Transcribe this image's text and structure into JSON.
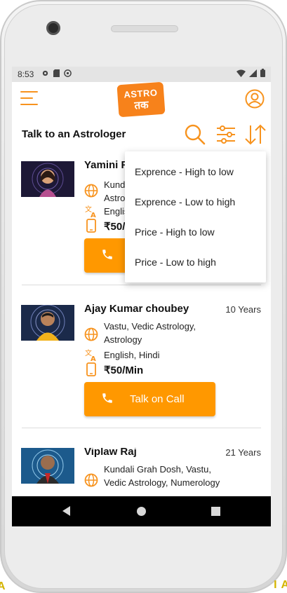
{
  "status_bar": {
    "time": "8:53",
    "left_icons": [
      "gear-icon",
      "sd-card-icon",
      "sync-icon"
    ],
    "right_icons": [
      "wifi-icon",
      "signal-icon",
      "battery-icon"
    ]
  },
  "app_bar": {
    "logo_line1": "ASTRO",
    "logo_line2": "तक"
  },
  "toolbar": {
    "title": "Talk to an Astrologer"
  },
  "sort_menu": {
    "options": [
      "Exprence - High to low",
      "Exprence - Low to high",
      "Price - High to low",
      "Price - Low to high"
    ]
  },
  "astrologers": [
    {
      "name": "Yamini R",
      "experience": "",
      "skills": "Kund\nAstro",
      "languages": "Englis",
      "price": "₹50/",
      "call_label": ""
    },
    {
      "name": "Ajay Kumar choubey",
      "experience": "10 Years",
      "skills": "Vastu, Vedic Astrology, Astrology",
      "languages": "English, Hindi",
      "price": "₹50/Min",
      "call_label": "Talk on Call"
    },
    {
      "name": "Viplaw Raj",
      "experience": "21 Years",
      "skills": "Kundali Grah Dosh, Vastu, Vedic Astrology, Numerology",
      "languages": "",
      "price": "",
      "call_label": ""
    }
  ],
  "colors": {
    "accent": "#ff9800",
    "icon_orange": "#f7931e",
    "logo": "#f7821b"
  }
}
